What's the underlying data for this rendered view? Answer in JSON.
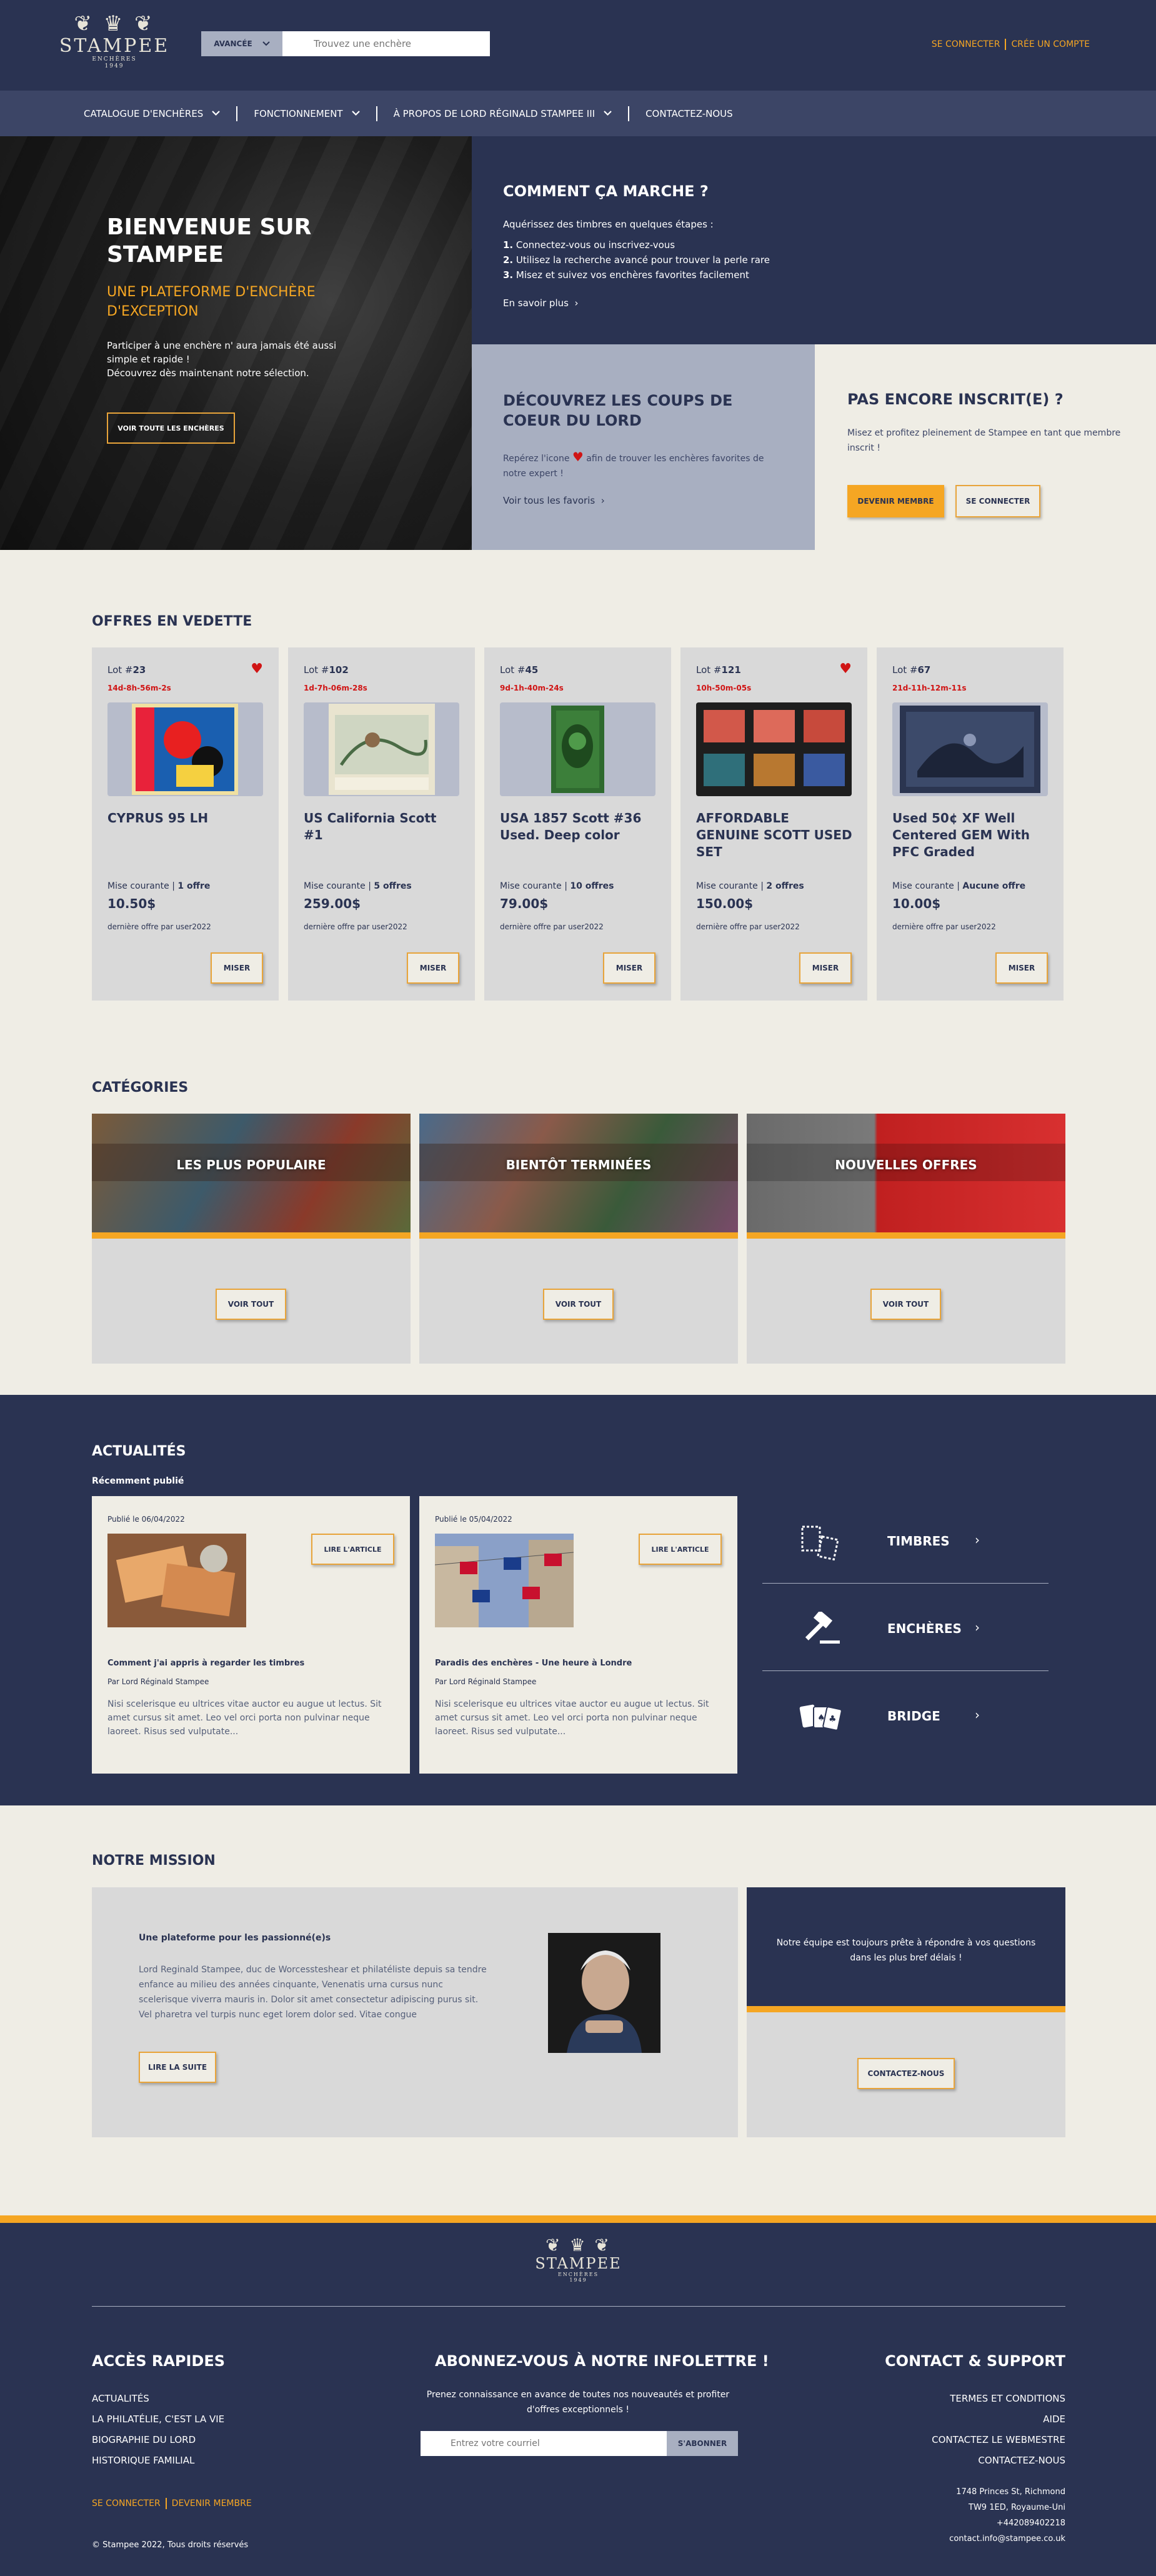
{
  "header": {
    "logo_crest": "❦ ♛ ❦",
    "logo_name": "STAMPEE",
    "logo_sub1": "ENCHÈRES",
    "logo_sub2": "1949",
    "search_adv_label": "AVANCÉE",
    "search_placeholder": "Trouvez une enchère",
    "login": "SE CONNECTER",
    "register": "CRÉE UN COMPTE"
  },
  "nav": [
    {
      "label": "CATALOGUE D'ENCHÈRES"
    },
    {
      "label": "FONCTIONNEMENT"
    },
    {
      "label": "À PROPOS DE LORD RÉGINALD STAMPEE III"
    },
    {
      "label": "CONTACTEZ-NOUS"
    }
  ],
  "hero": {
    "title": "BIENVENUE SUR STAMPEE",
    "subtitle": "UNE PLATEFORME D'ENCHÈRE D'EXCEPTION",
    "text1": "Participer à une enchère n' aura jamais été aussi simple et rapide !",
    "text2": "Découvrez dès maintenant notre sélection.",
    "button": "VOIR TOUTE LES ENCHÈRES"
  },
  "how": {
    "title": "COMMENT ÇA MARCHE ?",
    "intro": "Aquérissez des timbres en quelques étapes :",
    "steps": [
      {
        "n": "1.",
        "t": "Connectez-vous ou inscrivez-vous"
      },
      {
        "n": "2.",
        "t": "Utilisez la recherche avancé pour trouver la perle rare"
      },
      {
        "n": "3.",
        "t": "Misez et suivez vos enchères favorites facilement"
      }
    ],
    "link": "En savoir plus"
  },
  "favorites": {
    "title": "DÉCOUVREZ LES COUPS DE COEUR DU LORD",
    "text_before": "Repérez l'icone",
    "text_after": "afin de trouver les enchères favorites de notre expert !",
    "link": "Voir tous les favoris"
  },
  "join": {
    "title": "PAS ENCORE INSCRIT(E) ?",
    "text": "Misez et profitez pleinement de Stampee en tant que membre inscrit !",
    "member_button": "DEVENIR MEMBRE",
    "login_button": "SE CONNECTER"
  },
  "featured": {
    "title": "OFFRES EN VEDETTE",
    "lot_prefix": "Lot #",
    "current_label": "Mise courante",
    "bid_button": "MISER",
    "items": [
      {
        "lot": "23",
        "timer": "14d-8h-56m-2s",
        "title": "CYPRUS 95 LH",
        "offers": "1 offre",
        "price": "10.50$",
        "last": "dernière offre par user2022",
        "favorite": true
      },
      {
        "lot": "102",
        "timer": "1d-7h-06m-28s",
        "title": "US California Scott #1",
        "offers": "5 offres",
        "price": "259.00$",
        "last": "dernière offre par user2022",
        "favorite": false
      },
      {
        "lot": "45",
        "timer": "9d-1h-40m-24s",
        "title": "USA 1857 Scott #36 Used. Deep color",
        "offers": "10 offres",
        "price": "79.00$",
        "last": "dernière offre par user2022",
        "favorite": false
      },
      {
        "lot": "121",
        "timer": "10h-50m-05s",
        "title": "AFFORDABLE GENUINE SCOTT USED SET",
        "offers": "2 offres",
        "price": "150.00$",
        "last": "dernière offre par user2022",
        "favorite": true
      },
      {
        "lot": "67",
        "timer": "21d-11h-12m-11s",
        "title": "Used 50¢ XF Well Centered GEM With PFC Graded",
        "offers": "Aucune offre",
        "price": "10.00$",
        "last": "dernière offre par user2022",
        "favorite": false
      }
    ]
  },
  "categories": {
    "title": "CATÉGORIES",
    "button": "VOIR TOUT",
    "items": [
      {
        "label": "LES PLUS POPULAIRE"
      },
      {
        "label": "BIENTÔT TERMINÉES"
      },
      {
        "label": "NOUVELLES OFFRES"
      }
    ]
  },
  "news": {
    "title": "ACTUALITÉS",
    "subtitle": "Récemment publié",
    "read_button": "LIRE L'ARTICLE",
    "articles": [
      {
        "date": "Publié le 06/04/2022",
        "title": "Comment j'ai appris à regarder les timbres",
        "author": "Par Lord Réginald Stampee",
        "excerpt": "Nisi scelerisque eu ultrices vitae auctor eu augue ut lectus. Sit amet cursus sit amet. Leo vel orci porta non pulvinar neque laoreet. Risus sed vulputate..."
      },
      {
        "date": "Publié le 05/04/2022",
        "title": "Paradis des enchères - Une heure à Londre",
        "author": "Par Lord Réginald Stampee",
        "excerpt": "Nisi scelerisque eu ultrices vitae auctor eu augue ut lectus. Sit amet cursus sit amet. Leo vel orci porta non pulvinar neque laoreet. Risus sed vulputate..."
      }
    ],
    "topics": [
      {
        "label": "TIMBRES",
        "icon": "stamps-icon"
      },
      {
        "label": "ENCHÈRES",
        "icon": "gavel-icon"
      },
      {
        "label": "BRIDGE",
        "icon": "cards-icon"
      }
    ]
  },
  "mission": {
    "title": "NOTRE MISSION",
    "heading": "Une plateforme pour les passionné(e)s",
    "text": "Lord Reginald Stampee, duc de Worcessteshear et philatéliste depuis sa tendre enfance au milieu des années cinquante, Venenatis urna cursus nunc scelerisque viverra mauris in. Dolor sit amet consectetur adipiscing purus sit. Vel pharetra vel turpis nunc eget lorem dolor sed. Vitae congue",
    "button": "LIRE LA SUITE",
    "support_text": "Notre équipe est toujours prête à répondre à vos questions dans les plus bref délais !",
    "support_button": "CONTACTEZ-NOUS"
  },
  "footer": {
    "quick_title": "ACCÈS RAPIDES",
    "quick_links": [
      "ACTUALITÉS",
      "LA PHILATÉLIE, C'EST LA VIE",
      "BIOGRAPHIE DU LORD",
      "HISTORIQUE FAMILIAL"
    ],
    "login": "SE CONNECTER",
    "member": "DEVENIR MEMBRE",
    "copyright": "© Stampee 2022, Tous droits réservés",
    "newsletter_title": "ABONNEZ-VOUS À NOTRE INFOLETTRE !",
    "newsletter_text": "Prenez connaissance en avance de toutes nos nouveautés et profiter d'offres exceptionnels !",
    "newsletter_placeholder": "Entrez votre courriel",
    "newsletter_button": "S'ABONNER",
    "contact_title": "CONTACT & SUPPORT",
    "contact_links": [
      "TERMES ET CONDITIONS",
      "AIDE",
      "CONTACTEZ LE WEBMESTRE",
      "CONTACTEZ-NOUS"
    ],
    "address1": "1748 Princes St, Richmond",
    "address2": "TW9 1ED, Royaume-Uni",
    "phone": "+442089402218",
    "email": "contact.info@stampee.co.uk"
  },
  "colors": {
    "navy": "#2a3352",
    "orange": "#f5a623",
    "cream": "#efede5",
    "grey": "#d9d9d9",
    "heart": "#d01515"
  }
}
